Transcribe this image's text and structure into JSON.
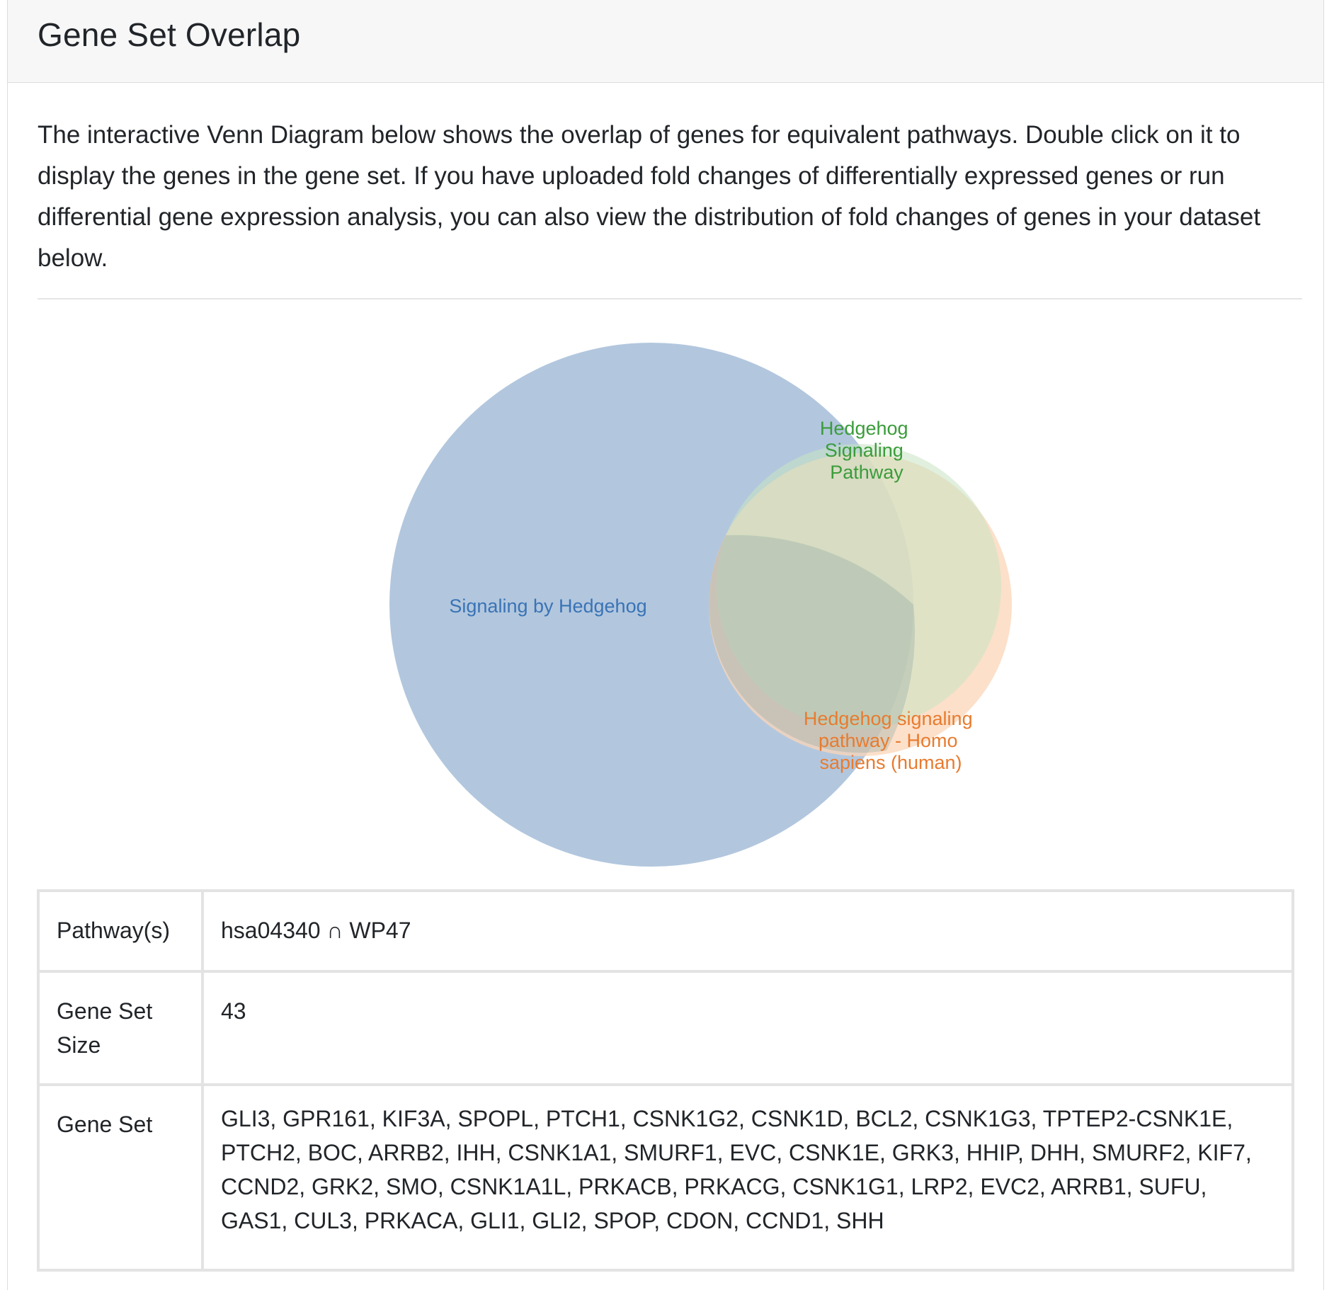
{
  "card": {
    "title": "Gene Set Overlap",
    "description": "The interactive Venn Diagram below shows the overlap of genes for equivalent pathways. Double click on it to display the genes in the gene set. If you have uploaded fold changes of differentially expressed genes or run differential gene expression analysis, you can also view the distribution of fold changes of genes in your dataset below."
  },
  "venn": {
    "sets": [
      {
        "label_lines": [
          "Signaling by Hedgehog"
        ],
        "fill": "#b2c7de",
        "text_color": "#3a73b5"
      },
      {
        "label_lines": [
          "Hedgehog",
          "Signaling",
          "Pathway"
        ],
        "fill": "#c8e3c3",
        "text_color": "#3b9c3b"
      },
      {
        "label_lines": [
          "Hedgehog signaling",
          "pathway - Homo",
          "sapiens (human)"
        ],
        "fill": "#fbd5b8",
        "text_color": "#e87b2f"
      }
    ]
  },
  "table": {
    "rows": [
      {
        "label": "Pathway(s)",
        "value": "hsa04340 ∩ WP47"
      },
      {
        "label": "Gene Set Size",
        "value": "43"
      },
      {
        "label": "Gene Set",
        "value": "GLI3, GPR161, KIF3A, SPOPL, PTCH1, CSNK1G2, CSNK1D, BCL2, CSNK1G3, TPTEP2-CSNK1E, PTCH2, BOC, ARRB2, IHH, CSNK1A1, SMURF1, EVC, CSNK1E, GRK3, HHIP, DHH, SMURF2, KIF7, CCND2, GRK2, SMO, CSNK1A1L, PRKACB, PRKACG, CSNK1G1, LRP2, EVC2, ARRB1, SUFU, GAS1, CUL3, PRKACA, GLI1, GLI2, SPOP, CDON, CCND1, SHH"
      }
    ]
  }
}
